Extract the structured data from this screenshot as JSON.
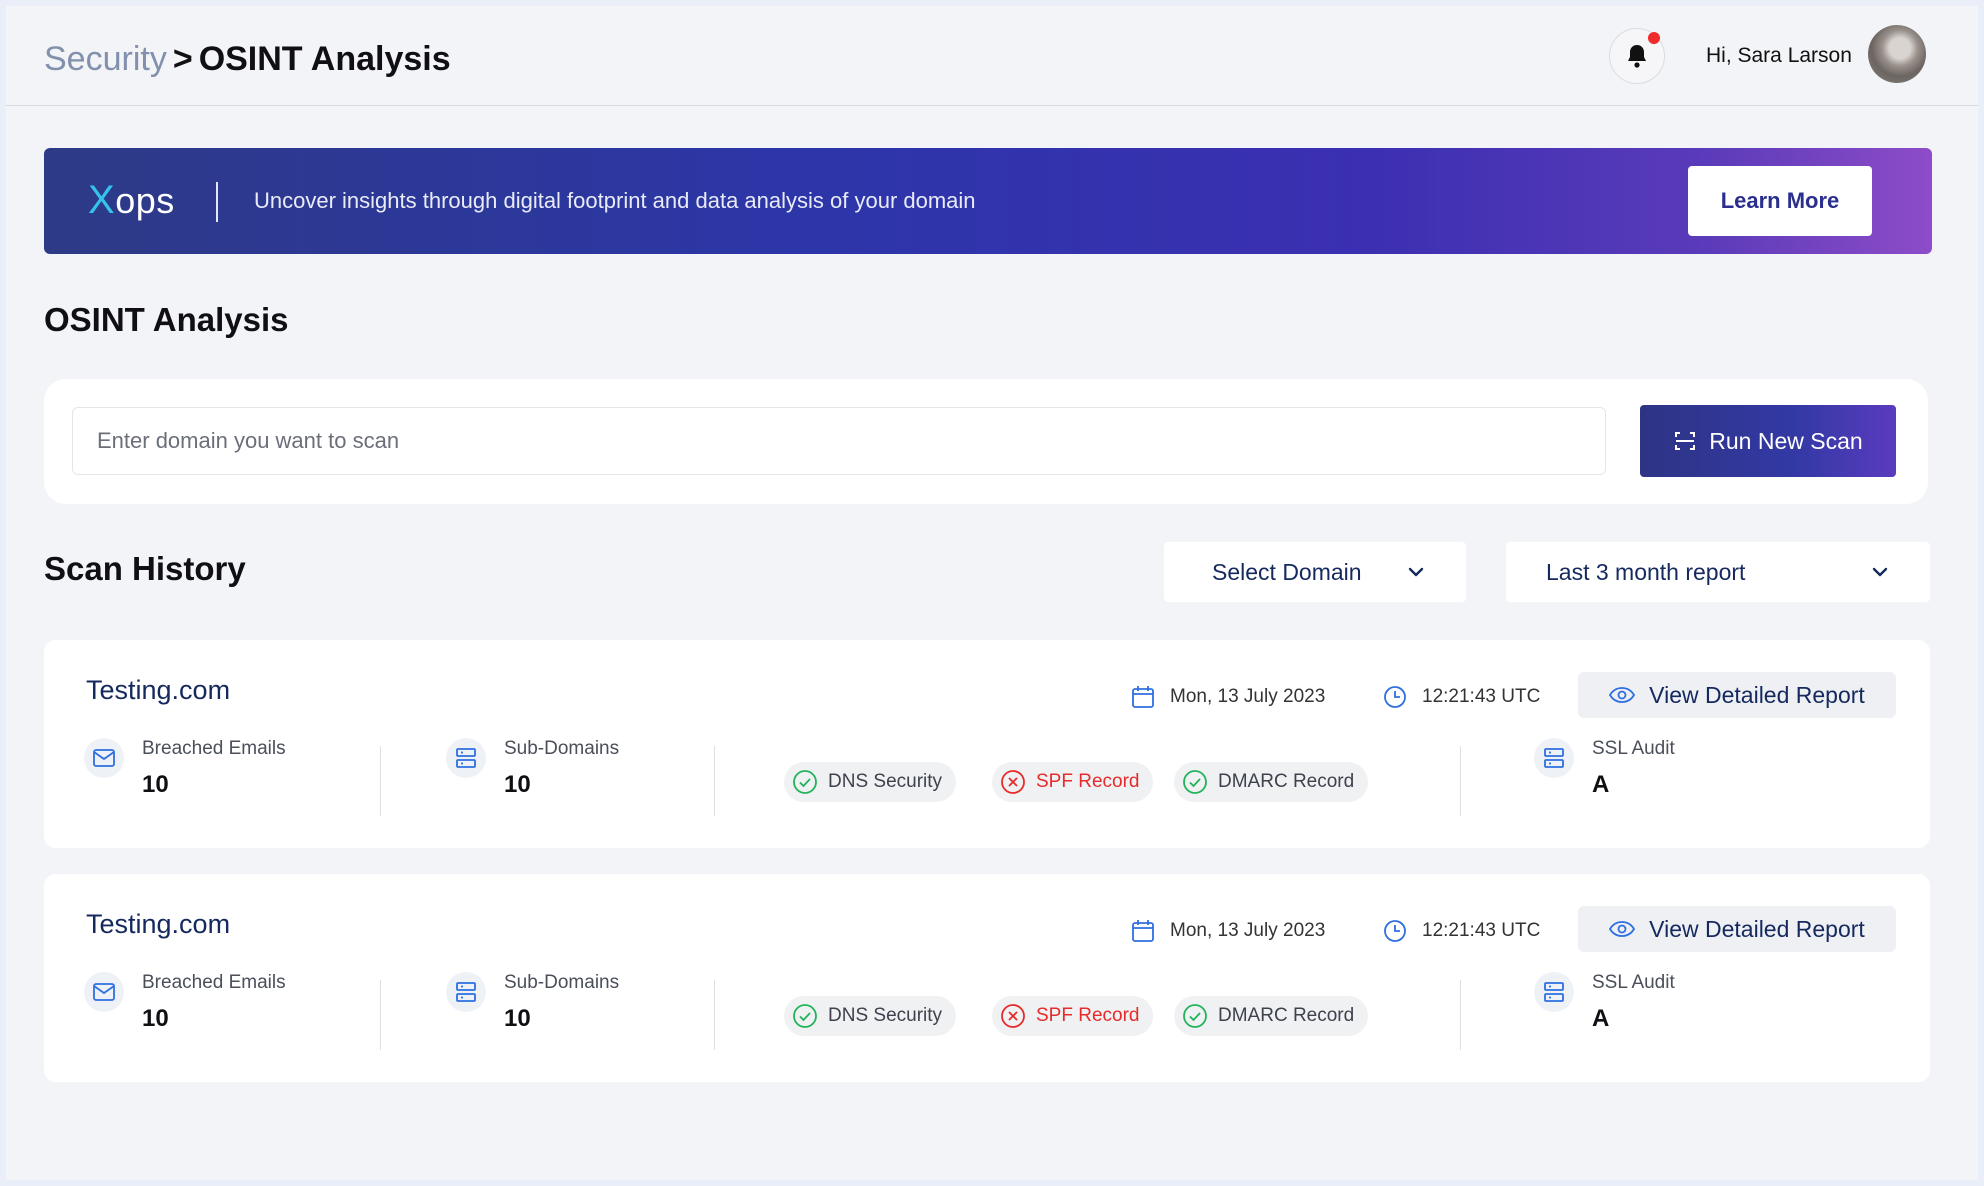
{
  "header": {
    "breadcrumb_parent": "Security",
    "breadcrumb_sep": ">",
    "breadcrumb_current": "OSINT Analysis",
    "greeting": "Hi, Sara Larson"
  },
  "banner": {
    "logo_x": "X",
    "logo_rest": "ops",
    "tagline": "Uncover insights through digital footprint and data analysis of your domain",
    "cta": "Learn More"
  },
  "page": {
    "title": "OSINT Analysis"
  },
  "scan": {
    "placeholder": "Enter domain you want to scan",
    "button": "Run New Scan"
  },
  "history": {
    "title": "Scan History",
    "domain_filter": "Select Domain",
    "period_filter": "Last 3 month report"
  },
  "records": [
    {
      "domain": "Testing.com",
      "date": "Mon, 13 July  2023",
      "time": "12:21:43  UTC",
      "view": "View Detailed Report",
      "breached_label": "Breached Emails",
      "breached_value": "10",
      "subdomains_label": "Sub-Domains",
      "subdomains_value": "10",
      "checks": [
        {
          "label": "DNS Security",
          "ok": true
        },
        {
          "label": "SPF Record",
          "ok": false
        },
        {
          "label": "DMARC Record",
          "ok": true
        }
      ],
      "ssl_label": "SSL Audit",
      "ssl_value": "A"
    },
    {
      "domain": "Testing.com",
      "date": "Mon, 13 July  2023",
      "time": "12:21:43  UTC",
      "view": "View Detailed Report",
      "breached_label": "Breached Emails",
      "breached_value": "10",
      "subdomains_label": "Sub-Domains",
      "subdomains_value": "10",
      "checks": [
        {
          "label": "DNS Security",
          "ok": true
        },
        {
          "label": "SPF Record",
          "ok": false
        },
        {
          "label": "DMARC Record",
          "ok": true
        }
      ],
      "ssl_label": "SSL Audit",
      "ssl_value": "A"
    }
  ],
  "colors": {
    "brand_navy": "#15295e",
    "ok_green": "#22b35a",
    "error_red": "#e52b2b",
    "icon_blue": "#2f6fe0"
  }
}
